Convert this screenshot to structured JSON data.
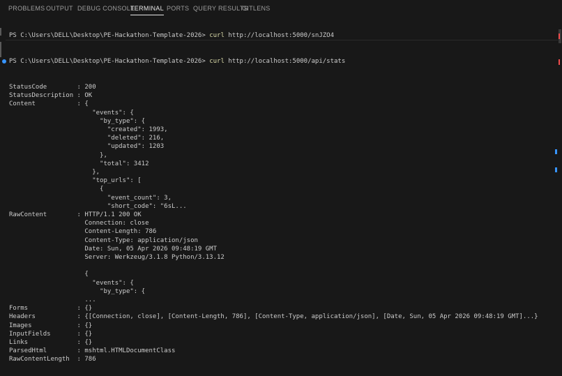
{
  "tabs": [
    {
      "label": "PROBLEMS"
    },
    {
      "label": "OUTPUT"
    },
    {
      "label": "DEBUG CONSOLE"
    },
    {
      "label": "TERMINAL"
    },
    {
      "label": "PORTS"
    },
    {
      "label": "QUERY RESULTS"
    },
    {
      "label": "GITLENS"
    }
  ],
  "active_tab": "TERMINAL",
  "prompt": "PS C:\\Users\\DELL\\Desktop\\PE-Hackathon-Template-2026> ",
  "commands": [
    {
      "cmd": "curl",
      "arg": " http://localhost:5000/snJZO4"
    },
    {
      "cmd": "curl",
      "arg": " http://localhost:5000/api/stats"
    }
  ],
  "output_lines": [
    "StatusCode        : 200",
    "StatusDescription : OK",
    "Content           : {",
    "                      \"events\": {",
    "                        \"by_type\": {",
    "                          \"created\": 1993,",
    "                          \"deleted\": 216,",
    "                          \"updated\": 1203",
    "                        },",
    "                        \"total\": 3412",
    "                      },",
    "                      \"top_urls\": [",
    "                        {",
    "                          \"event_count\": 3,",
    "                          \"short_code\": \"6sL...",
    "RawContent        : HTTP/1.1 200 OK",
    "                    Connection: close",
    "                    Content-Length: 786",
    "                    Content-Type: application/json",
    "                    Date: Sun, 05 Apr 2026 09:48:19 GMT",
    "                    Server: Werkzeug/3.1.8 Python/3.13.12",
    "",
    "                    {",
    "                      \"events\": {",
    "                        \"by_type\": {",
    "                    ...",
    "Forms             : {}",
    "Headers           : {[Connection, close], [Content-Length, 786], [Content-Type, application/json], [Date, Sun, 05 Apr 2026 09:48:19 GMT]...}",
    "Images            : {}",
    "InputFields       : {}",
    "Links             : {}",
    "ParsedHtml        : mshtml.HTMLDocumentClass",
    "RawContentLength  : 786"
  ],
  "colors": {
    "background": "#181818",
    "text": "#cccccc",
    "command": "#dcdcaa",
    "accent_blue": "#3794ff",
    "error_red": "#f14c4c"
  }
}
